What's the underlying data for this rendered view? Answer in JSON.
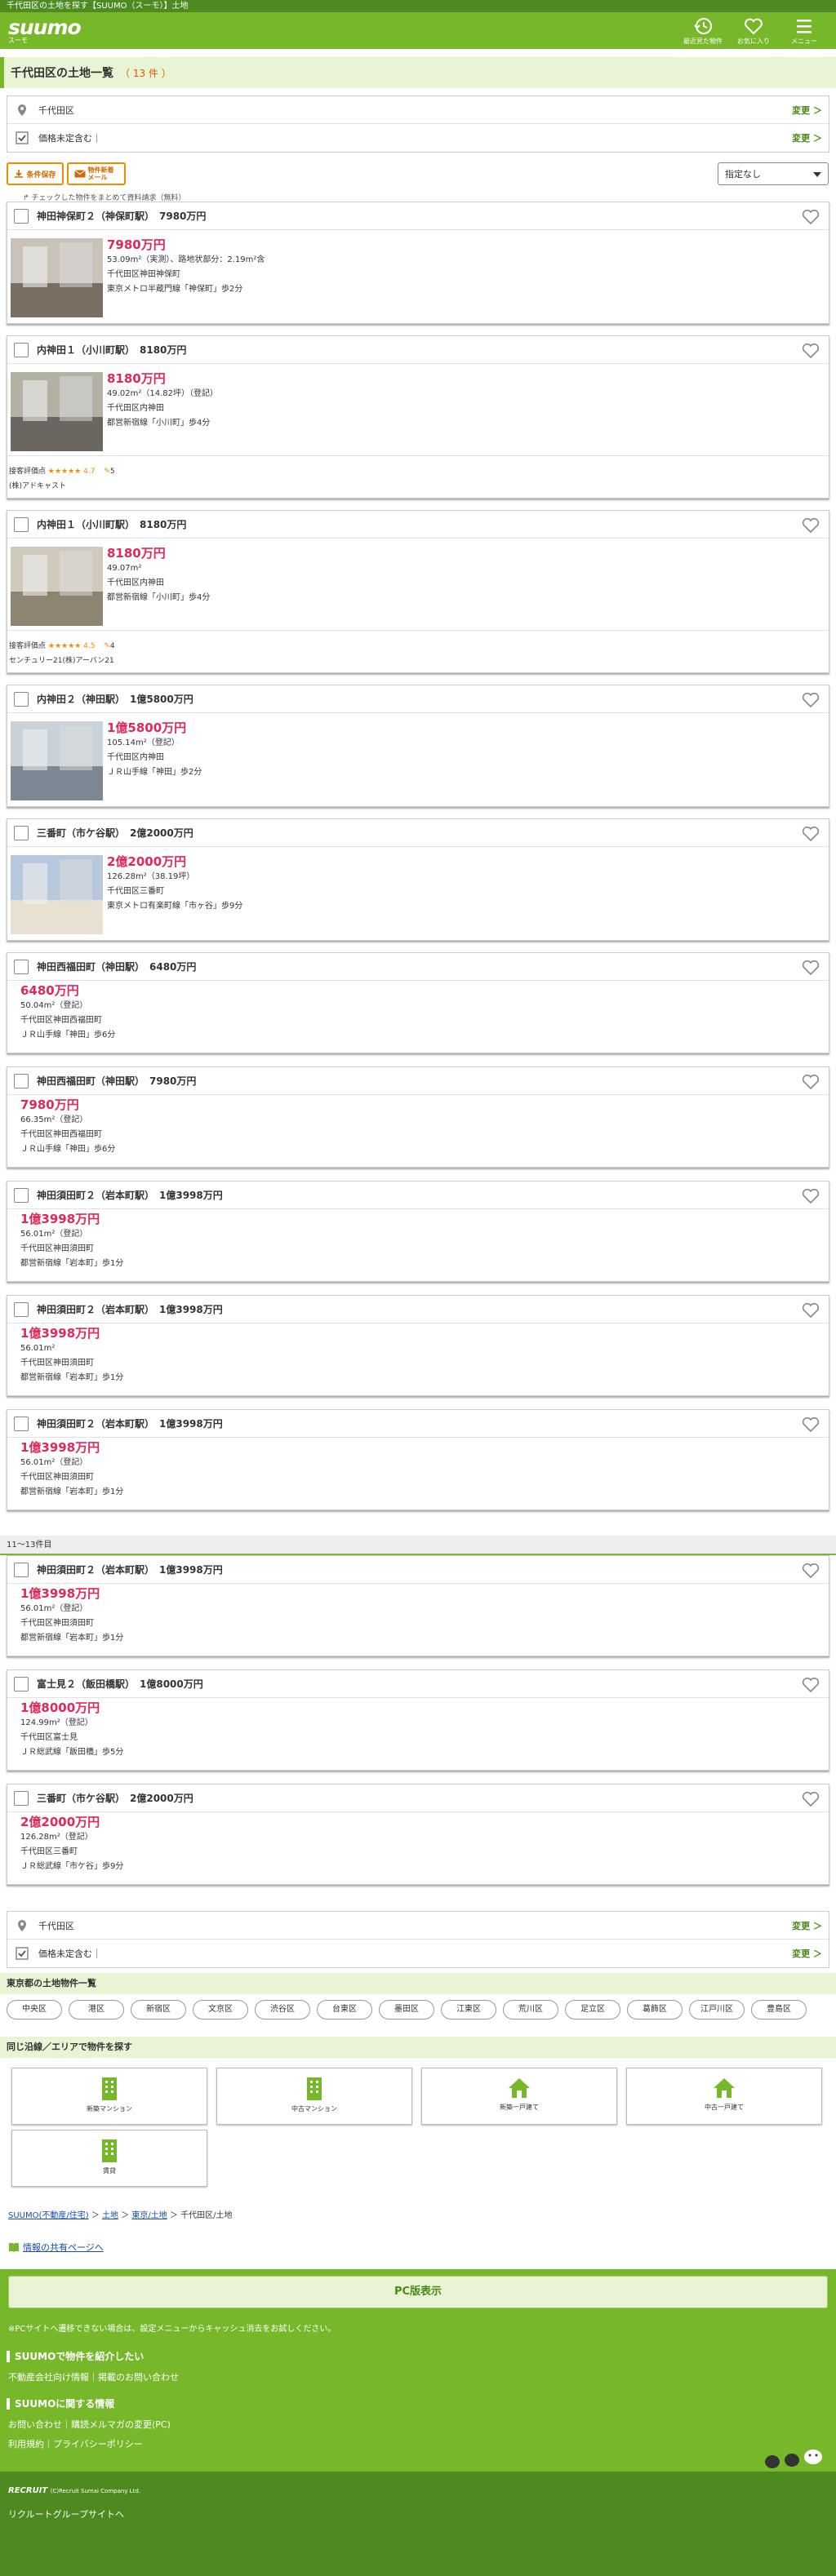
{
  "topbar": {
    "text": "千代田区の土地を探す【SUUMO（スーモ）】土地"
  },
  "header": {
    "logo": "suumo",
    "logo_sub": "スーモ",
    "nav": [
      {
        "label": "最近見た物件",
        "icon": "history-icon"
      },
      {
        "label": "お気に入り",
        "icon": "heart-icon"
      },
      {
        "label": "メニュー",
        "icon": "menu-icon"
      }
    ]
  },
  "page": {
    "title": "千代田区の土地一覧",
    "count": "（ 13 件 ）"
  },
  "conditions": [
    {
      "label": "千代田区",
      "icon": "pin-icon",
      "change": "変更 ＞"
    },
    {
      "label": "価格未定含む｜",
      "icon": "checkbox-icon",
      "change": "変更 ＞"
    }
  ],
  "actions": {
    "save": "条件保存",
    "mail": "物件新着メール",
    "sort": "指定なし",
    "note": "チェックした物件をまとめて資料請求（無料）"
  },
  "listings": [
    {
      "title": "神田神保町２（神保町駅）　7980万円",
      "price": "7980万円",
      "details": [
        "53.09m²（実測）、路地状部分：2.19m²含",
        "千代田区神田神保町",
        "東京メトロ半蔵門線「神保町」歩2分"
      ],
      "rating": null
    },
    {
      "title": "内神田１（小川町駅）　8180万円",
      "price": "8180万円",
      "details": [
        "49.02m²（14.82坪）（登記）",
        "千代田区内神田",
        "都営新宿線「小川町」歩4分"
      ],
      "rating": {
        "label": "接客評価点",
        "stars": "★★★★★",
        "score": "4.7",
        "count": "5",
        "company": "(株)アドキャスト"
      }
    },
    {
      "title": "内神田１（小川町駅）　8180万円",
      "price": "8180万円",
      "details": [
        "49.07m²",
        "千代田区内神田",
        "都営新宿線「小川町」歩4分"
      ],
      "rating": {
        "label": "接客評価点",
        "stars": "★★★★★",
        "score": "4.5",
        "count": "4",
        "company": "センチュリー21(株)アーバン21"
      }
    },
    {
      "title": "内神田２（神田駅）　1億5800万円",
      "price": "1億5800万円",
      "details": [
        "105.14m²（登記）",
        "千代田区内神田",
        "ＪＲ山手線「神田」歩2分"
      ],
      "rating": null
    },
    {
      "title": "三番町（市ケ谷駅）　2億2000万円",
      "price": "2億2000万円",
      "details": [
        "126.28m²（38.19坪）",
        "千代田区三番町",
        "東京メトロ有楽町線「市ヶ谷」歩9分"
      ],
      "rating": null
    },
    {
      "title": "神田西福田町（神田駅）　6480万円",
      "price": "6480万円",
      "details": [
        "50.04m²（登記）",
        "千代田区神田西福田町",
        "ＪＲ山手線「神田」歩6分"
      ],
      "rating": null
    },
    {
      "title": "神田西福田町（神田駅）　7980万円",
      "price": "7980万円",
      "details": [
        "66.35m²（登記）",
        "千代田区神田西福田町",
        "ＪＲ山手線「神田」歩6分"
      ],
      "rating": null
    },
    {
      "title": "神田須田町２（岩本町駅）　1億3998万円",
      "price": "1億3998万円",
      "details": [
        "56.01m²（登記）",
        "千代田区神田須田町",
        "都営新宿線「岩本町」歩1分"
      ],
      "rating": null
    },
    {
      "title": "神田須田町２（岩本町駅）　1億3998万円",
      "price": "1億3998万円",
      "details": [
        "56.01m²",
        "千代田区神田須田町",
        "都営新宿線「岩本町」歩1分"
      ],
      "rating": null
    },
    {
      "title": "神田須田町２（岩本町駅）　1億3998万円",
      "price": "1億3998万円",
      "details": [
        "56.01m²（登記）",
        "千代田区神田須田町",
        "都営新宿線「岩本町」歩1分"
      ],
      "rating": null
    },
    {
      "title": "神田須田町２（岩本町駅）　1億3998万円",
      "price": "1億3998万円",
      "details": [
        "56.01m²（登記）",
        "千代田区神田須田町",
        "都営新宿線「岩本町」歩1分"
      ],
      "rating": null
    },
    {
      "title": "富士見２（飯田橋駅）　1億8000万円",
      "price": "1億8000万円",
      "details": [
        "124.99m²（登記）",
        "千代田区富士見",
        "ＪＲ総武線「飯田橋」歩5分"
      ],
      "rating": null
    },
    {
      "title": "三番町（市ケ谷駅）　2億2000万円",
      "price": "2億2000万円",
      "details": [
        "126.28m²（登記）",
        "千代田区三番町",
        "ＪＲ総武線「市ケ谷」歩9分"
      ],
      "rating": null
    }
  ],
  "page_divider": "11〜13件目",
  "section_wards": {
    "title": "東京都の土地物件一覧",
    "wards": [
      "中央区",
      "港区",
      "新宿区",
      "文京区",
      "渋谷区",
      "台東区",
      "墨田区",
      "江東区",
      "荒川区",
      "足立区",
      "葛飾区",
      "江戸川区",
      "豊島区"
    ]
  },
  "section_categories": {
    "title": "同じ沿線／エリアで物件を探す",
    "items": [
      "新築マンション",
      "中古マンション",
      "新築一戸建て",
      "中古一戸建て",
      "賃貸"
    ]
  },
  "breadcrumb": [
    "SUUMO(不動産/住宅)",
    "土地",
    "東京/土地",
    "千代田区/土地"
  ],
  "share_link": "情報の共有ページへ",
  "footer": {
    "pc": "PC版表示",
    "note": "※PCサイトへ遷移できない場合は、設定メニューからキャッシュ消去をお試しください。",
    "intro_title": "SUUMOで物件を紹介したい",
    "intro_links": "不動産会社向け情報｜掲載のお問い合わせ",
    "about_title": "SUUMOに関する情報",
    "about_links1": "お問い合わせ｜購読メルマガの変更(PC)",
    "about_links2": "利用規約｜プライバシーポリシー",
    "recruit": "RECRUIT",
    "copyright": "(C)Recruit Sumai Company Ltd.",
    "group": "リクルートグループサイトへ"
  },
  "colors": {
    "brand": "#76b82a",
    "price": "#e0285a",
    "accent": "#f08c00"
  }
}
